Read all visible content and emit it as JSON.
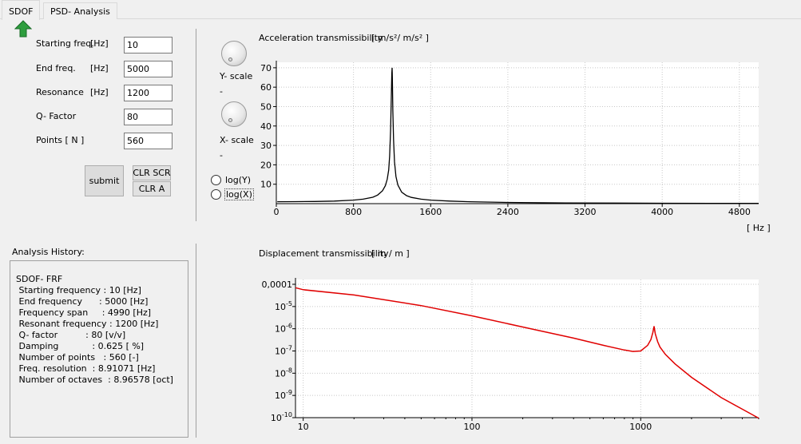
{
  "tabs": [
    {
      "label": "SDOF",
      "active": true
    },
    {
      "label": "PSD- Analysis",
      "active": false
    }
  ],
  "form": {
    "start": {
      "label": "Starting freq.",
      "unit": "[Hz]",
      "value": "10"
    },
    "end": {
      "label": "End freq.",
      "unit": "[Hz]",
      "value": "5000"
    },
    "resonance": {
      "label": "Resonance",
      "unit": "[Hz]",
      "value": "1200"
    },
    "q": {
      "label": "Q- Factor",
      "unit": "",
      "value": "80"
    },
    "points": {
      "label": "Points [ N ]",
      "unit": "",
      "value": "560"
    }
  },
  "buttons": {
    "submit": "submit",
    "clr_scr": "CLR SCR",
    "clr_a": "CLR A"
  },
  "controls": {
    "y_scale": "Y- scale",
    "y_scale_value": "-",
    "x_scale": "X- scale",
    "x_scale_value": "-",
    "log_y": "log(Y)",
    "log_x": "log(X)"
  },
  "history": {
    "title": "Analysis History:",
    "lines": [
      "SDOF- FRF",
      " Starting frequency : 10 [Hz]",
      " End frequency      : 5000 [Hz]",
      " Frequency span     : 4990 [Hz]",
      " Resonant frequency : 1200 [Hz]",
      " Q- factor          : 80 [v/v]",
      " Damping            : 0.625 [ %]",
      " Number of points   : 560 [-]",
      " Freq. resolution  : 8.91071 [Hz]",
      " Number of octaves  : 8.96578 [oct]"
    ]
  },
  "colors": {
    "accel_line": "#000000",
    "disp_line": "#e00000",
    "grid": "#c8c8c8",
    "arrow": "#2e9e3e"
  },
  "icons": {
    "back": "green-up-arrow-icon",
    "knob": "dial-knob-icon"
  },
  "chart_data": [
    {
      "type": "line",
      "title": "Acceleration transmissibility",
      "unit_label": "[ m/s²/ m/s² ]",
      "xlabel": "[ Hz ]",
      "ylabel": "",
      "xlim": [
        0,
        5000
      ],
      "ylim": [
        0,
        72
      ],
      "x_ticks": [
        0,
        800,
        1600,
        2400,
        3200,
        4000,
        4800
      ],
      "y_ticks": [
        10,
        20,
        30,
        40,
        50,
        60,
        70
      ],
      "grid": true,
      "series": [
        {
          "x": [
            10,
            200,
            400,
            600,
            800,
            900,
            1000,
            1050,
            1100,
            1130,
            1150,
            1165,
            1175,
            1185,
            1192,
            1197,
            1200,
            1203,
            1208,
            1215,
            1225,
            1240,
            1260,
            1300,
            1350,
            1400,
            1500,
            1600,
            1800,
            2000,
            2400,
            3000,
            3500,
            4000,
            4500,
            5000
          ],
          "y": [
            1.0,
            1.03,
            1.12,
            1.33,
            1.8,
            2.3,
            3.3,
            4.4,
            6.6,
            9.2,
            12.6,
            17.3,
            24.5,
            38,
            55,
            67,
            70,
            65,
            48,
            33,
            21.5,
            14,
            9.6,
            5.9,
            4.1,
            3.2,
            2.3,
            1.8,
            1.3,
            1.0,
            0.6,
            0.35,
            0.27,
            0.2,
            0.17,
            0.14
          ]
        }
      ]
    },
    {
      "type": "line",
      "title": "Displacement transmissibility",
      "unit_label": "[ m / m ]",
      "xlabel": "",
      "ylabel": "",
      "x_scale": "log",
      "y_scale": "log",
      "xlim": [
        9,
        5000
      ],
      "ylim": [
        1e-10,
        0.0001
      ],
      "x_ticks": [
        10,
        100,
        1000
      ],
      "y_tick_labels": [
        "0,0001",
        "10",
        "10",
        "10",
        "10",
        "10",
        "10"
      ],
      "y_tick_exponents": [
        "",
        "-5",
        "-6",
        "-7",
        "-8",
        "-9",
        "-10"
      ],
      "grid": true,
      "series": [
        {
          "x": [
            9,
            10,
            20,
            50,
            100,
            200,
            400,
            600,
            800,
            900,
            1000,
            1100,
            1150,
            1180,
            1200,
            1220,
            1260,
            1300,
            1400,
            1600,
            2000,
            3000,
            4000,
            5000
          ],
          "y": [
            7e-05,
            5.7e-05,
            3.3e-05,
            1.1e-05,
            3.8e-06,
            1.2e-06,
            3.8e-07,
            1.8e-07,
            1.1e-07,
            9.5e-08,
            1e-07,
            1.8e-07,
            3.3e-07,
            6.8e-07,
            1.3e-06,
            6e-07,
            2.6e-07,
            1.5e-07,
            7e-08,
            2.6e-08,
            6.5e-09,
            8e-10,
            2.4e-10,
            9.5e-11
          ]
        }
      ]
    }
  ]
}
